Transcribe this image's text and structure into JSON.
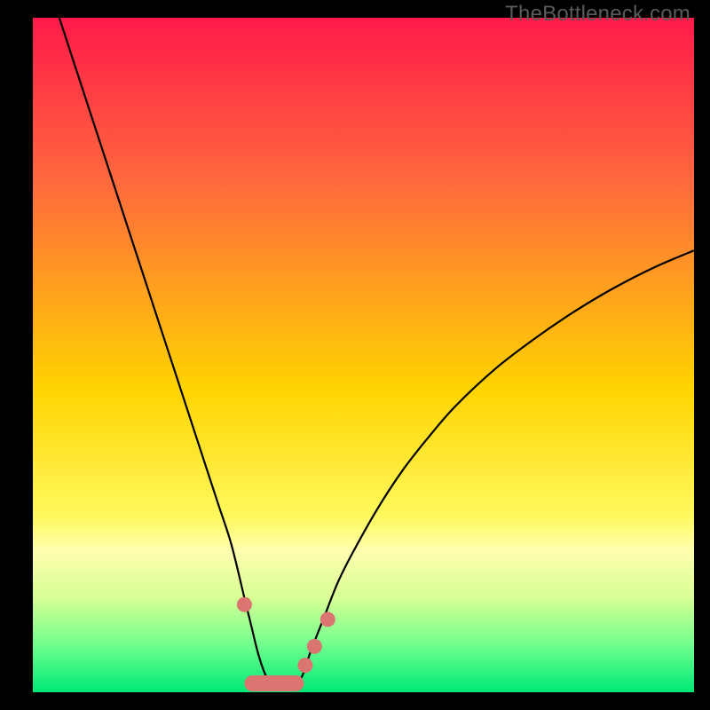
{
  "watermark": "TheBottleneck.com",
  "chart_data": {
    "type": "line",
    "title": "",
    "xlabel": "",
    "ylabel": "",
    "xlim": [
      0,
      100
    ],
    "ylim": [
      0,
      100
    ],
    "gradient_stops": [
      {
        "pct": 0,
        "color": "#ff1a49"
      },
      {
        "pct": 25,
        "color": "#ff6b3d"
      },
      {
        "pct": 55,
        "color": "#ffd400"
      },
      {
        "pct": 74,
        "color": "#fff95e"
      },
      {
        "pct": 79,
        "color": "#ffffb0"
      },
      {
        "pct": 86,
        "color": "#d7ff94"
      },
      {
        "pct": 93,
        "color": "#70ff8e"
      },
      {
        "pct": 100,
        "color": "#00e876"
      }
    ],
    "series": [
      {
        "name": "bottleneck-curve",
        "x": [
          4,
          6,
          8,
          10,
          12,
          14,
          16,
          18,
          20,
          22,
          24,
          26,
          28,
          30,
          32,
          33,
          34,
          35,
          36,
          37,
          38,
          39,
          40,
          41,
          42,
          44,
          46,
          48,
          52,
          56,
          60,
          64,
          70,
          76,
          82,
          88,
          94,
          100
        ],
        "y": [
          100,
          94,
          88,
          82,
          76,
          70,
          64,
          58,
          52,
          46,
          40,
          34,
          28,
          22,
          14,
          10,
          6,
          3,
          1.2,
          0.6,
          0.5,
          0.6,
          1.2,
          3,
          6,
          11,
          16,
          20,
          27,
          33,
          38,
          42.5,
          48,
          52.5,
          56.5,
          60,
          63,
          65.5
        ]
      }
    ],
    "markers": {
      "name": "highlight-dots",
      "x": [
        32.0,
        41.2,
        42.6,
        44.6
      ],
      "y": [
        13.0,
        4.0,
        6.8,
        10.8
      ]
    },
    "floor_bar": {
      "x_start": 32.0,
      "x_end": 41.0,
      "y": 0.0
    }
  }
}
